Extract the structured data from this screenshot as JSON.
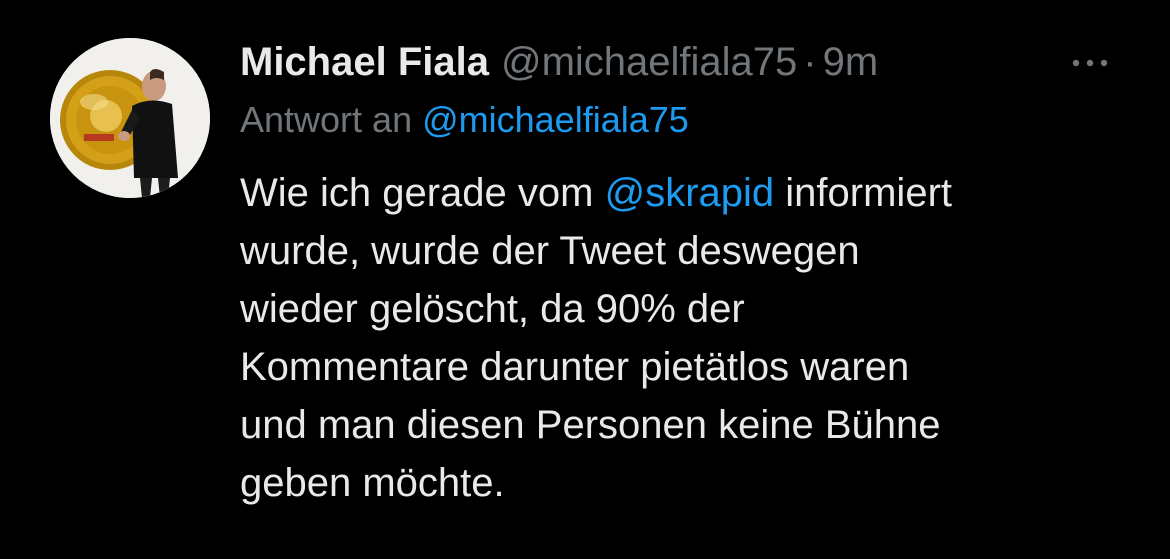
{
  "tweet": {
    "author": {
      "display_name": "Michael Fiala",
      "handle": "@michaelfiala75",
      "avatar_icon": "profile-photo"
    },
    "separator": "·",
    "time": "9m",
    "more_icon": "more-dots-icon",
    "reply": {
      "prefix": "Antwort an",
      "to_handle": "@michaelfiala75"
    },
    "text": {
      "line1_before": "Wie ich gerade vom",
      "line1_mention": "@skrapid",
      "line1_after": "informiert",
      "line2": "wurde, wurde der Tweet deswegen",
      "line3": "wieder gelöscht, da 90% der",
      "line4": "Kommentare darunter pietätlos waren",
      "line5": "und man diesen Personen keine Bühne",
      "line6": "geben möchte."
    }
  },
  "colors": {
    "background": "#000000",
    "primary_text": "#e7e9ea",
    "secondary_text": "#71767b",
    "link": "#1d9bf0"
  }
}
